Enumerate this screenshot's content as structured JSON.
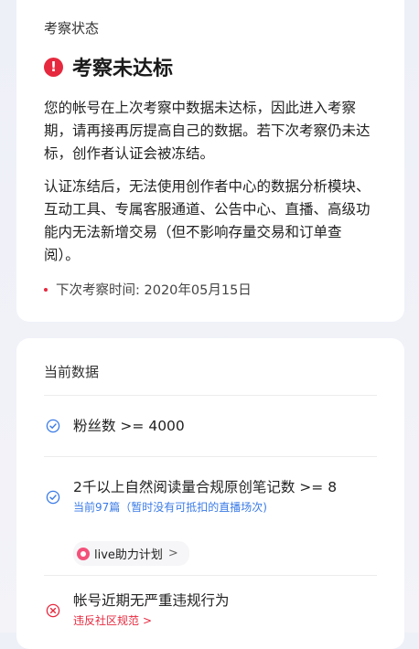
{
  "status": {
    "section_label": "考察状态",
    "title": "考察未达标",
    "paragraph_1": "您的帐号在上次考察中数据未达标，因此进入考察期，请再接再厉提高自己的数据。若下次考察仍未达标，创作者认证会被冻结。",
    "paragraph_2": "认证冻结后，无法使用创作者中心的数据分析模块、互动工具、专属客服通道、公告中心、直播、高级功能内无法新增交易（但不影响存量交易和订单查阅）。",
    "next_review": "下次考察时间: 2020年05月15日"
  },
  "current_data": {
    "section_label": "当前数据",
    "requirements": [
      {
        "text": "粉丝数 >= 4000",
        "status": "passed"
      },
      {
        "text": "2千以上自然阅读量合规原创笔记数 >= 8",
        "sub": "当前97篇（暂时没有可抵扣的直播场次)",
        "status": "passed",
        "chip_label": "live助力计划",
        "chip_chevron": ">"
      },
      {
        "text": "帐号近期无严重违规行为",
        "link": "违反社区规范",
        "link_chevron": ">",
        "status": "failed"
      }
    ]
  },
  "colors": {
    "alert_red": "#e6293e",
    "check_blue": "#3b7be6",
    "chip_pink": "#f3517a"
  },
  "icons": {
    "alert": "exclamation-circle-icon",
    "passed": "check-circle-icon",
    "failed": "x-circle-icon",
    "live": "live-icon"
  }
}
